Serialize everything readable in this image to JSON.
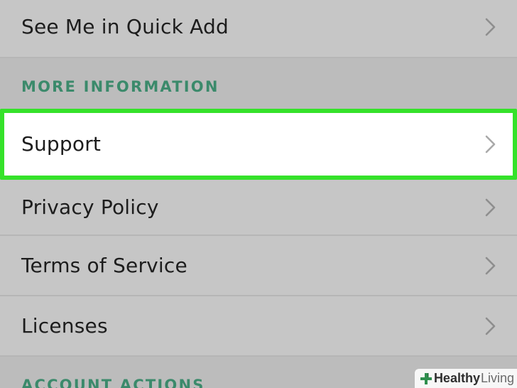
{
  "settings": {
    "quick_add_row": {
      "label": "See Me in Quick Add"
    },
    "more_info_section": {
      "header": "MORE INFORMATION"
    },
    "rows": [
      {
        "label": "Support",
        "highlighted": true
      },
      {
        "label": "Privacy Policy"
      },
      {
        "label": "Terms of Service"
      },
      {
        "label": "Licenses"
      }
    ],
    "account_section": {
      "header": "ACCOUNT ACTIONS"
    }
  },
  "colors": {
    "section_header": "#3b8a6b",
    "highlight_border": "#35e22a",
    "row_background": "#c6c6c6",
    "chevron": "#8e8e8e"
  },
  "icons": {
    "row_chevron": "chevron-right-icon",
    "watermark": "healthy-living-logo"
  },
  "watermark": {
    "brand_bold": "Healthy",
    "brand_light": "Living"
  }
}
